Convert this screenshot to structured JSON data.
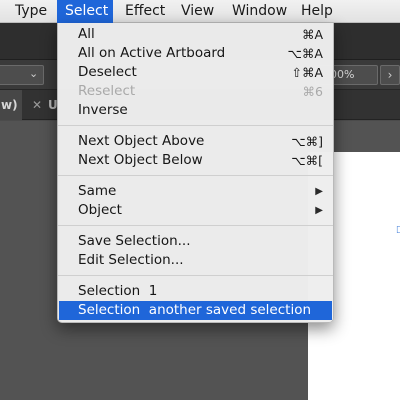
{
  "menubar": {
    "items": [
      "Type",
      "Select",
      "Effect",
      "View",
      "Window",
      "Help"
    ],
    "active": "Select"
  },
  "control_bar": {
    "opacity_value": "00%",
    "chevron_down": "⌄",
    "chevron_right": "›"
  },
  "tabs": {
    "active_fragment": "w)",
    "close_glyph": "✕",
    "second_fragment": "U"
  },
  "select_menu": {
    "groups": [
      [
        {
          "label": "All",
          "shortcut": "⌘A",
          "enabled": true
        },
        {
          "label": "All on Active Artboard",
          "shortcut": "⌥⌘A",
          "enabled": true
        },
        {
          "label": "Deselect",
          "shortcut": "⇧⌘A",
          "enabled": true
        },
        {
          "label": "Reselect",
          "shortcut": "⌘6",
          "enabled": false
        },
        {
          "label": "Inverse",
          "shortcut": "",
          "enabled": true
        }
      ],
      [
        {
          "label": "Next Object Above",
          "shortcut": "⌥⌘]",
          "enabled": true
        },
        {
          "label": "Next Object Below",
          "shortcut": "⌥⌘[",
          "enabled": true
        }
      ],
      [
        {
          "label": "Same",
          "submenu": true,
          "enabled": true
        },
        {
          "label": "Object",
          "submenu": true,
          "enabled": true
        }
      ],
      [
        {
          "label": "Save Selection...",
          "enabled": true
        },
        {
          "label": "Edit Selection...",
          "enabled": true
        }
      ],
      [
        {
          "label": "Selection  1",
          "enabled": true
        },
        {
          "label": "Selection  another saved selection",
          "enabled": true,
          "highlighted": true
        }
      ]
    ],
    "submenu_arrow": "▶"
  },
  "colors": {
    "menu_highlight": "#1f66d9",
    "menu_background": "#eeeeee",
    "disabled_text": "#a9a9a9",
    "workspace": "#535353"
  }
}
